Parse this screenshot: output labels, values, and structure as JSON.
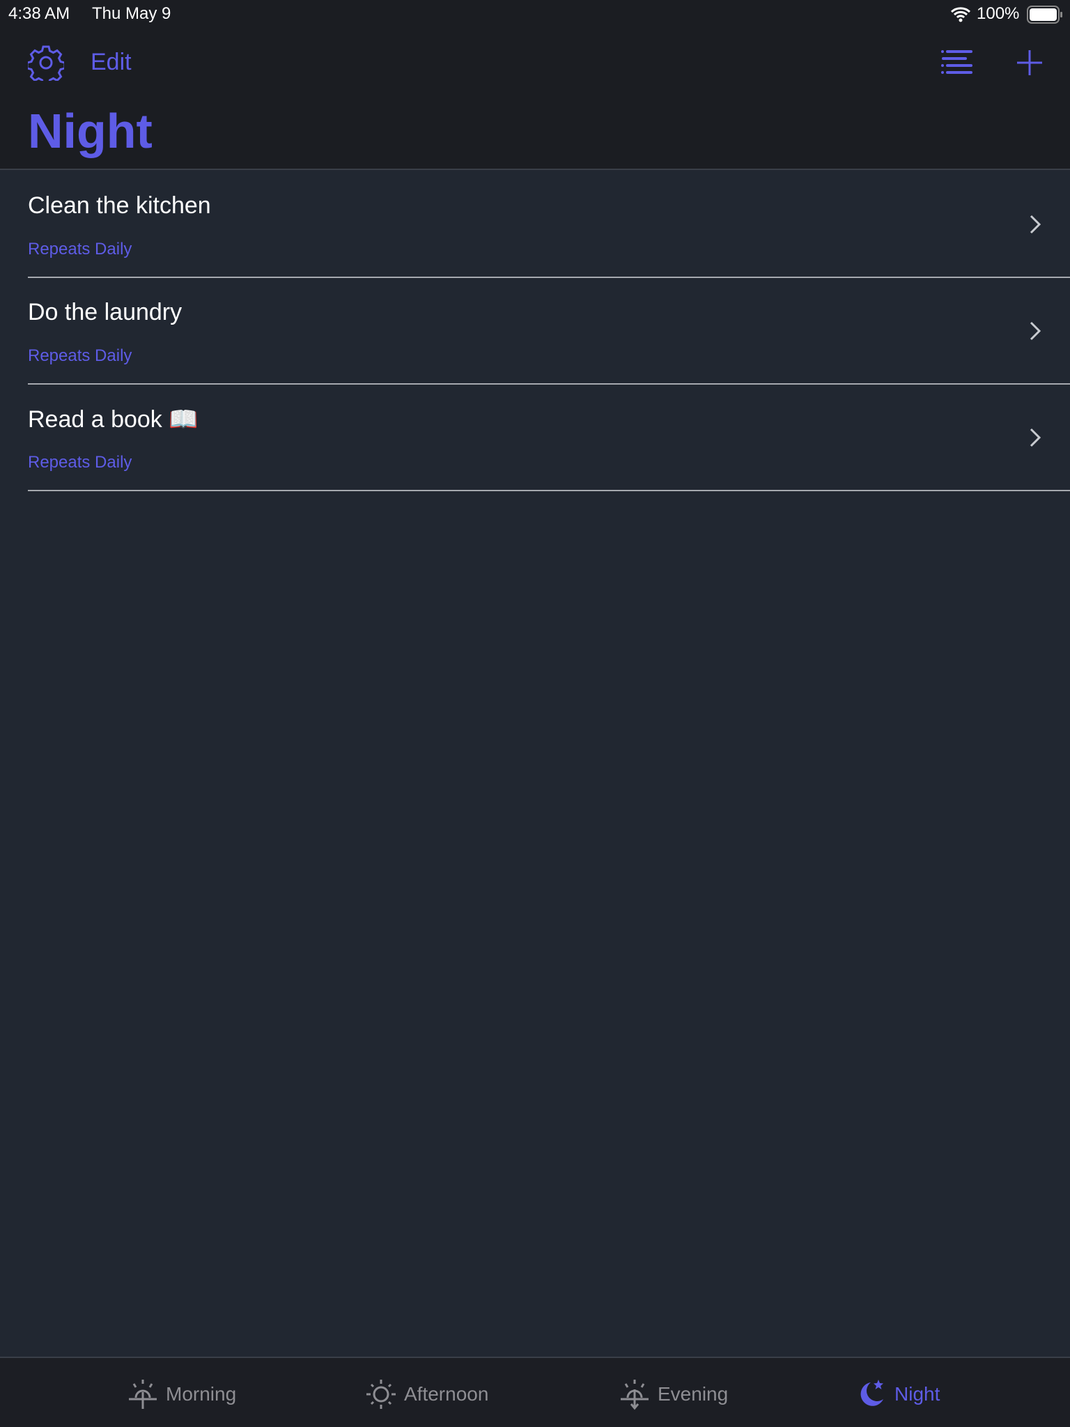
{
  "status_bar": {
    "time": "4:38 AM",
    "date": "Thu May 9",
    "battery": "100%"
  },
  "header": {
    "edit_label": "Edit",
    "title": "Night"
  },
  "tasks": [
    {
      "title": "Clean the kitchen",
      "subtitle": "Repeats Daily"
    },
    {
      "title": "Do the laundry",
      "subtitle": "Repeats Daily"
    },
    {
      "title": "Read a book 📖",
      "subtitle": "Repeats Daily"
    }
  ],
  "tabs": [
    {
      "label": "Morning",
      "icon": "sunrise-icon"
    },
    {
      "label": "Afternoon",
      "icon": "sun-icon"
    },
    {
      "label": "Evening",
      "icon": "sunset-icon"
    },
    {
      "label": "Night",
      "icon": "moon-stars-icon",
      "active": true
    }
  ],
  "colors": {
    "accent": "#5e5ce6",
    "background": "#212731",
    "header": "#1b1d22"
  }
}
